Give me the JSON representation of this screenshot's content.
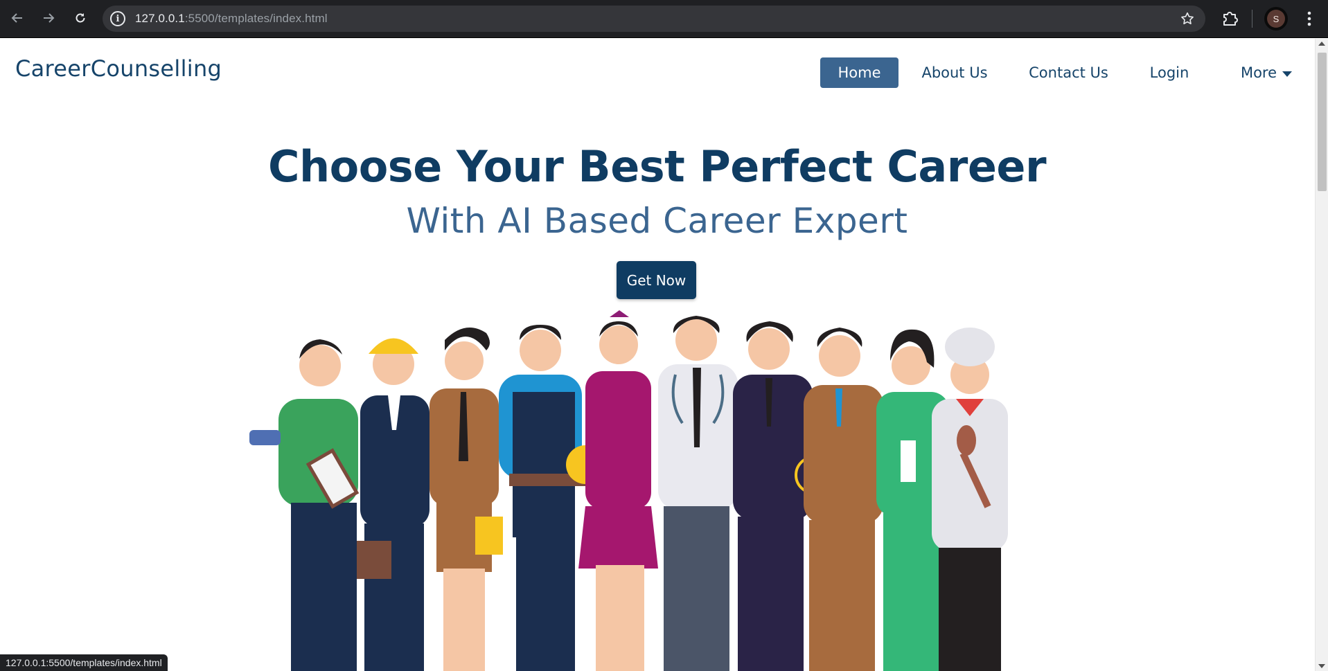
{
  "browser": {
    "url_host": "127.0.0.1",
    "url_rest": ":5500/templates/index.html",
    "profile_initial": "S",
    "status_url": "127.0.0.1:5500/templates/index.html"
  },
  "navbar": {
    "brand": "CareerCounselling",
    "items": [
      {
        "label": "Home",
        "active": true
      },
      {
        "label": "About Us",
        "active": false
      },
      {
        "label": "Contact Us",
        "active": false
      },
      {
        "label": "Login",
        "active": false
      },
      {
        "label": "More",
        "active": false
      }
    ]
  },
  "hero": {
    "title": "Choose Your Best Perfect Career",
    "subtitle": "With AI Based Career Expert",
    "cta_label": "Get Now"
  },
  "colors": {
    "primary_dark": "#0f3c62",
    "primary": "#3b6590",
    "brand_text": "#16446a"
  },
  "icons": {
    "back": "arrow-left-icon",
    "forward": "arrow-right-icon",
    "reload": "reload-icon",
    "site_info": "info-icon",
    "bookmark": "star-icon",
    "extensions": "puzzle-icon",
    "menu": "kebab-icon",
    "more_caret": "caret-down-icon"
  }
}
